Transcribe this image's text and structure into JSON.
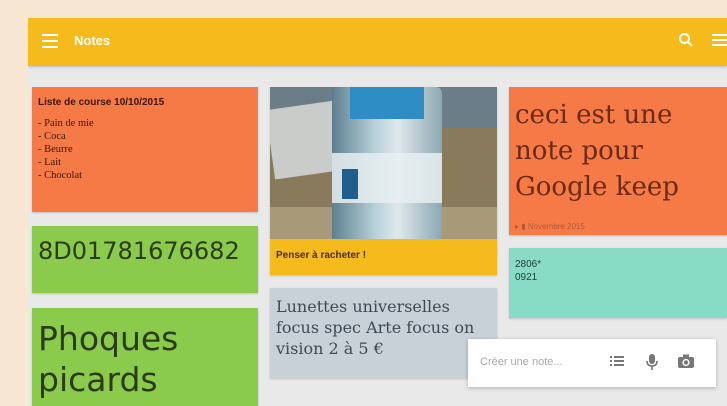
{
  "app": {
    "title": "Notes"
  },
  "notes": [
    {
      "title": "Liste de course 10/10/2015",
      "items": [
        "- Pain de mie",
        "- Coca",
        "- Beurre",
        "- Lait",
        "- Chocolat"
      ]
    },
    {
      "text": "8D01781676682"
    },
    {
      "lines": [
        "Phoques",
        "picards"
      ]
    },
    {
      "caption": "Penser à racheter !"
    },
    {
      "lines": [
        "Lunettes universelles",
        "focus spec Arte focus on",
        "vision 2 à 5 €"
      ]
    },
    {
      "lines": [
        "ceci est une",
        "note pour",
        "Google keep"
      ],
      "meta": "▸ ▮ Novembre 2015"
    },
    {
      "lines": [
        "2806*",
        "0921"
      ]
    }
  ],
  "composer": {
    "placeholder": "Créer une note..."
  },
  "icons": {
    "menu": "menu-icon",
    "search": "search-icon",
    "more": "more-icon",
    "list": "list-icon",
    "mic": "microphone-icon",
    "camera": "camera-icon"
  },
  "colors": {
    "appbar": "#f5bb1d",
    "orange": "#f67a45",
    "green": "#8bcb4c",
    "teal": "#88dcc6",
    "grey": "#c8d0d8",
    "yellow": "#f5bb1d"
  }
}
